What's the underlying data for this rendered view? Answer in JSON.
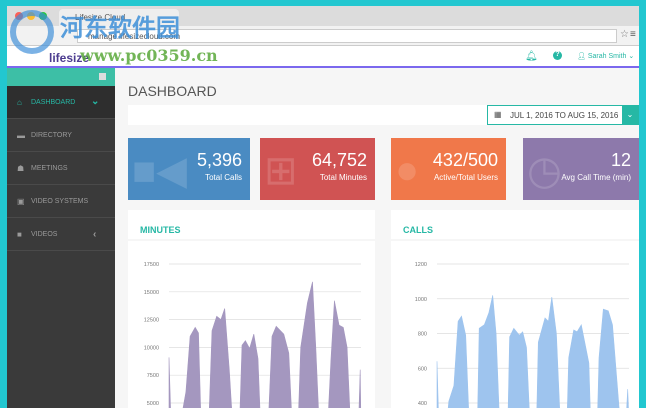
{
  "browser": {
    "tab_title": "Lifesize Cloud",
    "url": "manage.lifesizecloud.com"
  },
  "watermark": {
    "title": "河东软件园",
    "url": "www.pc0359.cn"
  },
  "header": {
    "logo": "lifesize",
    "user": "Sarah Smith",
    "bell_icon": "bell-icon",
    "help_icon": "help-icon"
  },
  "sidebar": {
    "items": [
      {
        "label": "DASHBOARD",
        "icon": "home-icon",
        "active": true
      },
      {
        "label": "DIRECTORY",
        "icon": "folder-icon"
      },
      {
        "label": "MEETINGS",
        "icon": "meetings-icon"
      },
      {
        "label": "VIDEO SYSTEMS",
        "icon": "video-system-icon"
      },
      {
        "label": "VIDEOS",
        "icon": "video-icon"
      }
    ]
  },
  "main": {
    "title": "DASHBOARD",
    "date_range": "JUL 1, 2016 TO AUG 15, 2016"
  },
  "cards": [
    {
      "value": "5,396",
      "label": "Total Calls",
      "color": "#4a8bc2"
    },
    {
      "value": "64,752",
      "label": "Total Minutes",
      "color": "#d05353"
    },
    {
      "value": "432/500",
      "label": "Active/Total Users",
      "color": "#f0784a"
    },
    {
      "value": "12",
      "label": "Avg Call Time (min)",
      "color": "#8d79ab"
    }
  ],
  "chart_data": [
    {
      "type": "area",
      "title": "MINUTES",
      "color": "#a497bf",
      "yticks": [
        "17500",
        "15000",
        "12500",
        "10000",
        "7500",
        "5000"
      ],
      "ylim": [
        5000,
        17500
      ],
      "xlim": [
        0,
        45.5
      ],
      "points": [
        [
          0,
          9100
        ],
        [
          0.5,
          3000
        ],
        [
          2.6,
          3000
        ],
        [
          4,
          6000
        ],
        [
          5,
          11000
        ],
        [
          6.2,
          11800
        ],
        [
          7,
          11300
        ],
        [
          7.6,
          3000
        ],
        [
          9.4,
          3000
        ],
        [
          10.2,
          11500
        ],
        [
          11.3,
          12800
        ],
        [
          12.3,
          12500
        ],
        [
          13.2,
          13500
        ],
        [
          14.3,
          8000
        ],
        [
          15.1,
          3000
        ],
        [
          16.7,
          3000
        ],
        [
          17.3,
          10200
        ],
        [
          18.1,
          10600
        ],
        [
          19.1,
          9900
        ],
        [
          20.1,
          11200
        ],
        [
          21.1,
          9000
        ],
        [
          21.7,
          3000
        ],
        [
          23.5,
          3000
        ],
        [
          24.4,
          11000
        ],
        [
          25.4,
          11900
        ],
        [
          27.2,
          11200
        ],
        [
          28.4,
          9500
        ],
        [
          29.2,
          3000
        ],
        [
          30.6,
          3000
        ],
        [
          31.2,
          10000
        ],
        [
          32.8,
          14000
        ],
        [
          34,
          15900
        ],
        [
          34.8,
          10000
        ],
        [
          35.6,
          3000
        ],
        [
          37.6,
          3000
        ],
        [
          38.4,
          9000
        ],
        [
          39.2,
          14200
        ],
        [
          40.3,
          12000
        ],
        [
          41.3,
          11800
        ],
        [
          42.2,
          10000
        ],
        [
          43,
          3000
        ],
        [
          44.9,
          3000
        ],
        [
          45.3,
          8000
        ],
        [
          45.5,
          3000
        ]
      ]
    },
    {
      "type": "area",
      "title": "CALLS",
      "color": "#9ec4ee",
      "yticks": [
        "1200",
        "1000",
        "800",
        "600",
        "400"
      ],
      "ylim": [
        400,
        1200
      ],
      "xlim": [
        0,
        45.5
      ],
      "points": [
        [
          0,
          640
        ],
        [
          0.4,
          300
        ],
        [
          2.4,
          300
        ],
        [
          2.8,
          410
        ],
        [
          4,
          500
        ],
        [
          5,
          870
        ],
        [
          5.8,
          900
        ],
        [
          6.8,
          790
        ],
        [
          7.6,
          300
        ],
        [
          9.6,
          300
        ],
        [
          10,
          830
        ],
        [
          11.2,
          850
        ],
        [
          12.3,
          920
        ],
        [
          13.2,
          1020
        ],
        [
          14,
          800
        ],
        [
          14.8,
          300
        ],
        [
          16.8,
          300
        ],
        [
          17.2,
          780
        ],
        [
          18.2,
          830
        ],
        [
          19.5,
          790
        ],
        [
          20.3,
          810
        ],
        [
          21.2,
          720
        ],
        [
          22,
          300
        ],
        [
          23.6,
          300
        ],
        [
          24,
          750
        ],
        [
          25.6,
          890
        ],
        [
          26.4,
          870
        ],
        [
          27.2,
          1010
        ],
        [
          28.3,
          800
        ],
        [
          29.2,
          300
        ],
        [
          30.8,
          300
        ],
        [
          31.2,
          660
        ],
        [
          32.4,
          820
        ],
        [
          33.2,
          810
        ],
        [
          34.2,
          850
        ],
        [
          36,
          630
        ],
        [
          36.4,
          300
        ],
        [
          38,
          300
        ],
        [
          38.4,
          660
        ],
        [
          39.4,
          940
        ],
        [
          40.6,
          930
        ],
        [
          41.6,
          850
        ],
        [
          43.4,
          300
        ],
        [
          44.8,
          300
        ],
        [
          45.2,
          480
        ],
        [
          45.5,
          300
        ]
      ]
    }
  ]
}
